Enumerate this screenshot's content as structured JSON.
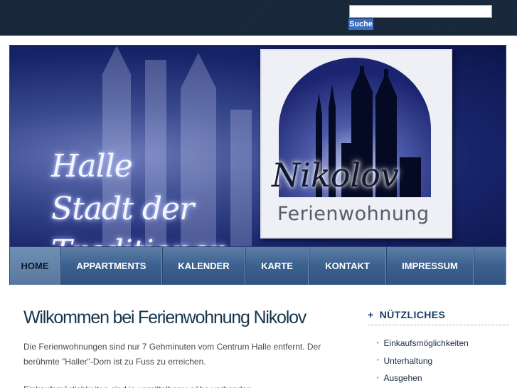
{
  "search": {
    "placeholder": "",
    "button_label": "Suche"
  },
  "banner": {
    "tagline_lines": [
      "Halle",
      "Stadt der",
      "Traditionen"
    ],
    "logo_name": "Nikolov",
    "logo_subtitle": "Ferienwohnung"
  },
  "nav": {
    "items": [
      {
        "label": "HOME",
        "active": true
      },
      {
        "label": "APPARTMENTS",
        "active": false
      },
      {
        "label": "KALENDER",
        "active": false
      },
      {
        "label": "KARTE",
        "active": false
      },
      {
        "label": "KONTAKT",
        "active": false
      },
      {
        "label": "IMPRESSUM",
        "active": false
      }
    ]
  },
  "main": {
    "title": "Wilkommen bei Ferienwohnung Nikolov",
    "intro": "Die Ferienwohnungen sind nur 7 Gehminuten vom Centrum Halle entfernt. Der berühmte \"Haller\"-Dom ist zu Fuss zu erreichen.",
    "next_line": "Einkaufsmöglichkeiten sind in unmittelbarer nähe vorhanden."
  },
  "sidebar": {
    "heading_marker": "+",
    "heading": "NÜTZLICHES",
    "bullet": "•",
    "links": [
      "Einkaufsmöglichkeiten",
      "Unterhaltung",
      "Ausgehen"
    ]
  },
  "colors": {
    "topbar": "#1a2a3c",
    "search_button": "#3b6dc0",
    "nav": "#3f6391",
    "title": "#15364d",
    "sidebar_heading": "#1a3d66"
  }
}
